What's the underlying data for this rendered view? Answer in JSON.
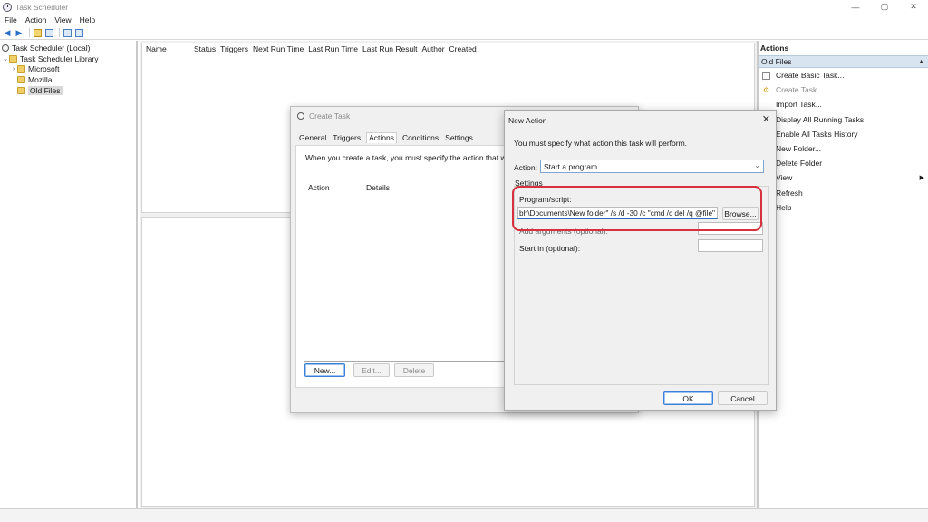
{
  "window": {
    "title": "Task Scheduler",
    "controls": [
      "—",
      "▢",
      "✕"
    ]
  },
  "menu": [
    "File",
    "Action",
    "View",
    "Help"
  ],
  "tree": {
    "items": [
      {
        "label": "Task Scheduler (Local)"
      },
      {
        "label": "Task Scheduler Library"
      },
      {
        "label": "Microsoft"
      },
      {
        "label": "Mozilla"
      },
      {
        "label": "Old Files"
      }
    ]
  },
  "task_list": {
    "columns": [
      "Name",
      "Status",
      "Triggers",
      "Next Run Time",
      "Last Run Time",
      "Last Run Result",
      "Author",
      "Created"
    ]
  },
  "actions_pane": {
    "title": "Actions",
    "section": "Old Files",
    "items": [
      {
        "label": "Create Basic Task..."
      },
      {
        "label": "Create Task..."
      },
      {
        "label": "Import Task..."
      },
      {
        "label": "Display All Running Tasks"
      },
      {
        "label": "Enable All Tasks History"
      },
      {
        "label": "New Folder..."
      },
      {
        "label": "Delete Folder"
      },
      {
        "label": "View"
      },
      {
        "label": "Refresh"
      },
      {
        "label": "Help"
      }
    ]
  },
  "create_task": {
    "title": "Create Task",
    "tabs": [
      "General",
      "Triggers",
      "Actions",
      "Conditions",
      "Settings"
    ],
    "description": "When you create a task, you must specify the action that will o",
    "list_columns": [
      "Action",
      "Details"
    ],
    "buttons": {
      "new": "New...",
      "edit": "Edit...",
      "delete": "Delete"
    }
  },
  "new_action": {
    "title": "New Action",
    "close": "✕",
    "instruction": "You must specify what action this task will perform.",
    "action_label": "Action:",
    "action_value": "Start a program",
    "settings_label": "Settings",
    "program_label": "Program/script:",
    "program_value": "bh\\Documents\\New folder\" /s /d -30 /c \"cmd /c del /q @file\"",
    "browse": "Browse...",
    "args_label": "Add arguments (optional):",
    "start_label": "Start in (optional):",
    "ok": "OK",
    "cancel": "Cancel"
  },
  "colors": {
    "highlight": "#d8303c",
    "accent": "#2c6cc2",
    "section_bg": "#d9e4f1"
  }
}
